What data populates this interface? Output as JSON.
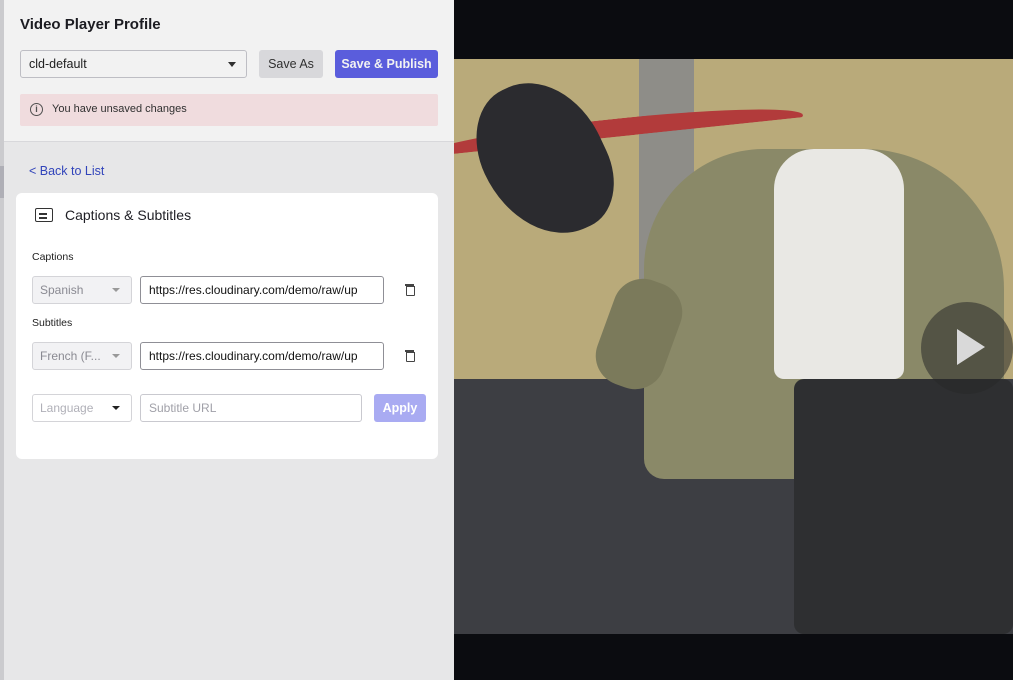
{
  "header": {
    "title": "Video Player Profile",
    "profile_select": "cld-default",
    "save_as_label": "Save As",
    "publish_label": "Save & Publish",
    "alert_text": "You have unsaved changes"
  },
  "nav": {
    "back_label": "< Back to List"
  },
  "card": {
    "title": "Captions & Subtitles",
    "captions_label": "Captions",
    "captions_language": "Spanish",
    "captions_url": "https://res.cloudinary.com/demo/raw/up",
    "subtitles_label": "Subtitles",
    "subtitles_language": "French (F...",
    "subtitles_url": "https://res.cloudinary.com/demo/raw/up",
    "new_language_placeholder": "Language",
    "new_url_placeholder": "Subtitle URL",
    "apply_label": "Apply"
  },
  "colors": {
    "accent": "#5f63e8",
    "apply_disabled": "#a9abf2",
    "alert_bg": "#fde8ea",
    "link": "#3448c5"
  },
  "icons": [
    "info-icon",
    "chevron-down-icon",
    "captions-icon",
    "trash-icon",
    "play-icon"
  ]
}
